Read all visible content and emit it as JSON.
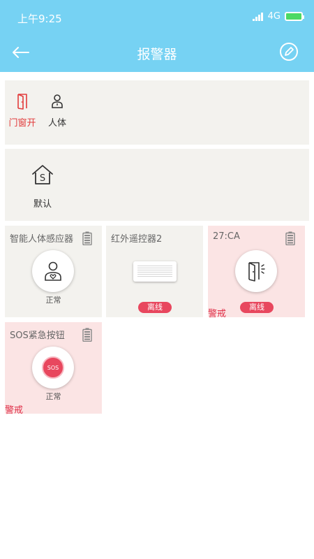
{
  "status_bar": {
    "time": "上午9:25",
    "network": "4G"
  },
  "header": {
    "title": "报警器"
  },
  "scenes": {
    "row1": [
      {
        "label": "门窗开",
        "icon": "door-open-icon",
        "color": "#e23b3b"
      },
      {
        "label": "人体",
        "icon": "person-icon",
        "color": "#333333"
      }
    ],
    "row2": [
      {
        "label": "默认",
        "icon": "home-s-icon",
        "color": "#333333"
      }
    ]
  },
  "devices": [
    {
      "name": "智能人体感应器",
      "icon": "person-heart-icon",
      "state": "正常",
      "has_battery": true
    },
    {
      "name": "红外遥控器2",
      "icon": "air-conditioner-icon",
      "badge": "离线"
    },
    {
      "name": "27:CA",
      "icon": "door-sensor-icon",
      "badge": "离线",
      "alert": "警戒",
      "has_battery": true
    },
    {
      "name": "SOS紧急按钮",
      "icon": "sos-icon",
      "icon_text": "SOS",
      "state": "正常",
      "alert": "警戒",
      "has_battery": true
    }
  ],
  "colors": {
    "header": "#76d2f3",
    "panel": "#f3f2ee",
    "alarm_tile": "#fbe4e4",
    "badge": "#e8475e",
    "alert_text": "#e0334b"
  }
}
